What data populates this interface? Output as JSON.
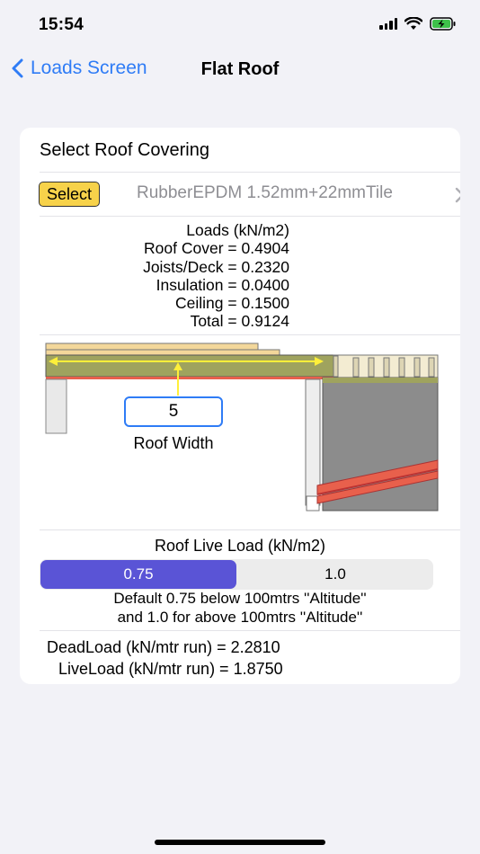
{
  "status_bar": {
    "time": "15:54"
  },
  "nav": {
    "back_label": "Loads Screen",
    "title": "Flat Roof"
  },
  "covering": {
    "header": "Select Roof Covering",
    "select_label": "Select",
    "selected_value": "RubberEPDM 1.52mm+22mmTile"
  },
  "loads": {
    "title": "Loads (kN/m2)",
    "roof_cover": "Roof Cover = 0.4904",
    "joists_deck": "Joists/Deck = 0.2320",
    "insulation": "Insulation = 0.0400",
    "ceiling": "Ceiling = 0.1500",
    "total": "Total = 0.9124"
  },
  "roof_width": {
    "value": "5",
    "label": "Roof Width"
  },
  "live_load": {
    "title": "Roof Live Load (kN/m2)",
    "options": [
      "0.75",
      "1.0"
    ],
    "selected": "0.75",
    "note_line1": "Default 0.75 below 100mtrs ''Altitude''",
    "note_line2": "and 1.0 for above 100mtrs ''Altitude''"
  },
  "results": {
    "dead_load": "DeadLoad (kN/mtr run) =  2.2810",
    "live_load": "LiveLoad (kN/mtr run) =  1.8750"
  },
  "colors": {
    "accent": "#2f7cf6",
    "select_button": "#f7d24a",
    "segment_active": "#5a54d6",
    "beam": "#e8604c",
    "wall": "#8c8c8c",
    "insulation": "#9fa35e",
    "deck": "#f3d79a"
  }
}
